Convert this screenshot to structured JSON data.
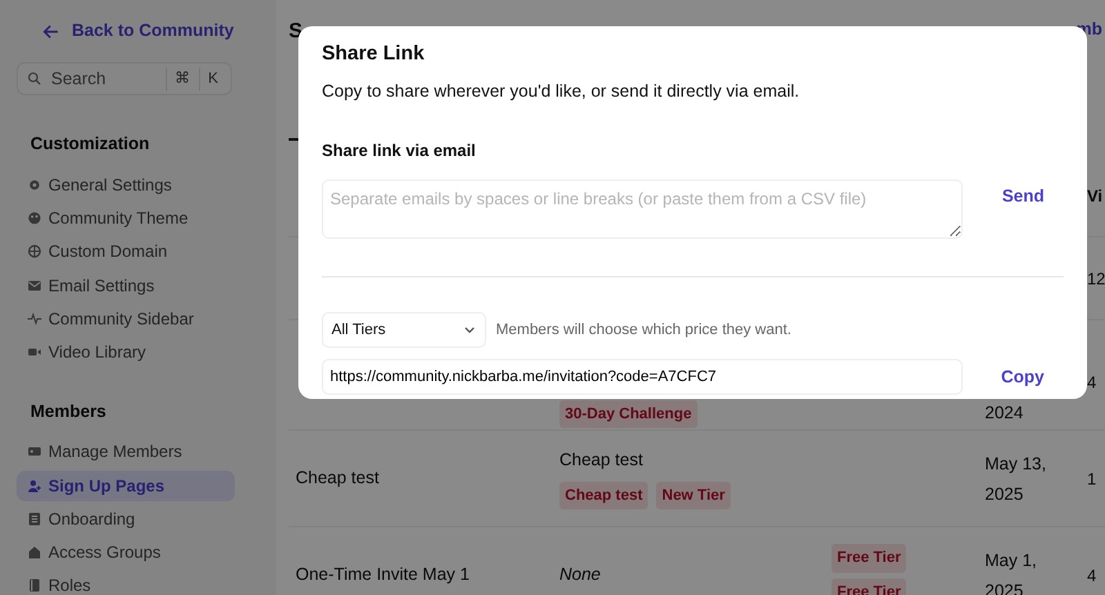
{
  "sidebar": {
    "back_link": "Back to Community",
    "search": {
      "placeholder": "Search",
      "keys": [
        "⌘",
        "K"
      ]
    },
    "sections": [
      {
        "title": "Customization",
        "items": [
          {
            "label": "General Settings",
            "selected": false
          },
          {
            "label": "Community Theme",
            "selected": false
          },
          {
            "label": "Custom Domain",
            "selected": false
          },
          {
            "label": "Email Settings",
            "selected": false
          },
          {
            "label": "Community Sidebar",
            "selected": false
          },
          {
            "label": "Video Library",
            "selected": false
          }
        ]
      },
      {
        "title": "Members",
        "items": [
          {
            "label": "Manage Members",
            "selected": false
          },
          {
            "label": "Sign Up Pages",
            "selected": true
          },
          {
            "label": "Onboarding",
            "selected": false
          },
          {
            "label": "Access Groups",
            "selected": false
          },
          {
            "label": "Roles",
            "selected": false
          }
        ]
      }
    ]
  },
  "main": {
    "title": "S",
    "header_link": "mb",
    "table": {
      "columns": [
        {
          "label": "Vi"
        }
      ],
      "rows": [
        {
          "visits": "12"
        },
        {
          "tags": [
            "30-Day Challenge"
          ],
          "date": "2024",
          "visits": "4"
        },
        {
          "name": "Cheap test",
          "description": {
            "text": "Cheap test",
            "italic": false
          },
          "tags": [
            "Cheap test",
            "New Tier"
          ],
          "date": "May 13, 2025",
          "visits": "1"
        },
        {
          "name": "One-Time Invite May 1",
          "description": {
            "text": "None",
            "italic": true
          },
          "tier_tags": [
            "Free Tier",
            "Free Tier"
          ],
          "date": "May 1, 2025",
          "visits": "4"
        }
      ]
    }
  },
  "modal": {
    "title": "Share Link",
    "subtitle": "Copy to share wherever you'd like, or send it directly via email.",
    "email_section": {
      "label": "Share link via email",
      "placeholder": "Separate emails by spaces or line breaks (or paste them from a CSV file)",
      "send_button": "Send"
    },
    "tier_select": {
      "value": "All Tiers"
    },
    "tier_note": "Members will choose which price they want.",
    "link": {
      "value": "https://community.nickbarba.me/invitation?code=A7CFC7"
    },
    "copy_button": "Copy"
  }
}
